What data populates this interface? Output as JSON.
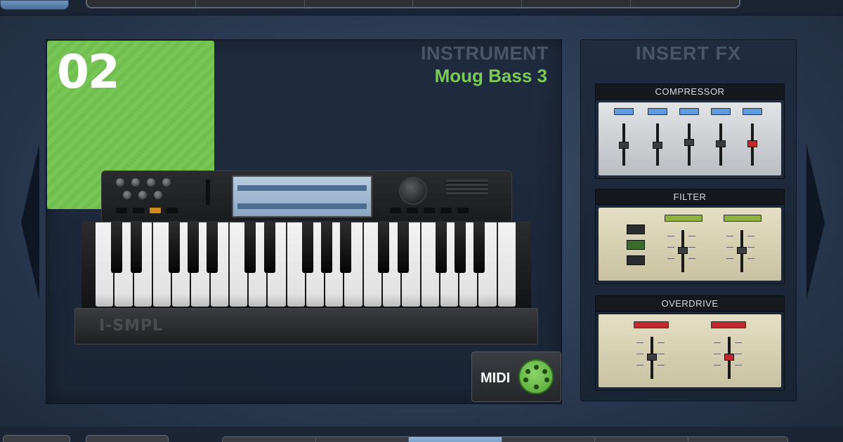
{
  "app": {
    "slot_number": "02",
    "instrument_label": "INSTRUMENT",
    "instrument_name": "Moug Bass 3",
    "keyboard_brand": "I-SMPL",
    "midi_label": "MIDI"
  },
  "insert_fx": {
    "title": "INSERT FX",
    "units": [
      {
        "name": "COMPRESSOR"
      },
      {
        "name": "FILTER"
      },
      {
        "name": "OVERDRIVE"
      }
    ]
  },
  "bottom_bar": {
    "tabs": [
      "",
      "",
      "",
      "",
      "",
      "",
      ""
    ],
    "active_tab_index": 2
  },
  "colors": {
    "slot_green": "#6fbe4e",
    "instrument_name_green": "#7ccb55",
    "label_gray": "#4a5566",
    "background_navy": "#26354b"
  }
}
